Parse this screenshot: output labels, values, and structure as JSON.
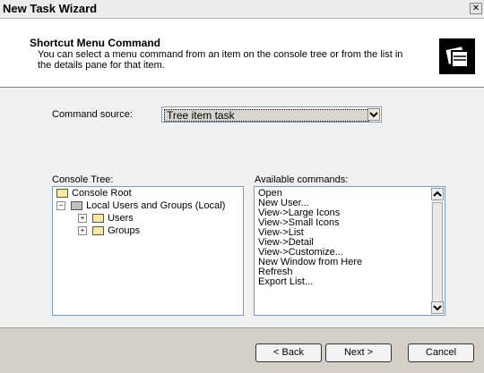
{
  "window": {
    "title": "New Task Wizard"
  },
  "header": {
    "title": "Shortcut Menu Command",
    "description": "You can select a menu command from an item on the console tree or from the list in the details pane for that item."
  },
  "command_source": {
    "label": "Command source:",
    "value": "Tree item task"
  },
  "console_tree": {
    "label": "Console Tree:",
    "items": [
      {
        "label": "Console Root",
        "expander": ""
      },
      {
        "label": "Local Users and Groups (Local)",
        "expander": "−"
      },
      {
        "label": "Users",
        "expander": "+"
      },
      {
        "label": "Groups",
        "expander": "+"
      }
    ]
  },
  "available_commands": {
    "label": "Available commands:",
    "items": [
      "Open",
      "New User...",
      "View->Large Icons",
      "View->Small Icons",
      "View->List",
      "View->Detail",
      "View->Customize...",
      "New Window from Here",
      "Refresh",
      "Export List..."
    ]
  },
  "buttons": {
    "back": "< Back",
    "next": "Next >",
    "cancel": "Cancel"
  }
}
